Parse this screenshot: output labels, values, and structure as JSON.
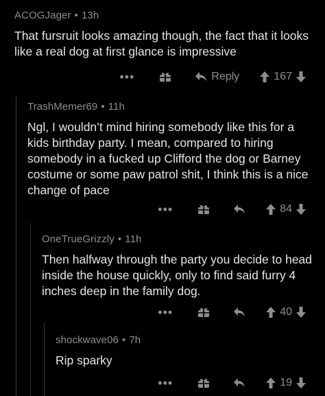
{
  "comments": [
    {
      "username": "ACOGJager",
      "age": "13h",
      "text": "That fursruit looks amazing though, the fact that it looks like a real dog at first glance is impressive",
      "reply_label": "Reply",
      "score": "167"
    },
    {
      "username": "TrashMemer69",
      "age": "11h",
      "text": "Ngl, I wouldn’t mind hiring somebody like this for a kids birthday party. I mean, compared to hiring somebody in a fucked up Clifford the dog or Barney costume or some paw patrol shit, I think this is a nice change of pace",
      "score": "84"
    },
    {
      "username": "OneTrueGrizzly",
      "age": "11h",
      "text": "Then halfway through the party you decide to head inside the house quickly, only to find said furry 4 inches deep in the family dog.",
      "score": "40"
    },
    {
      "username": "shockwave06",
      "age": "7h",
      "text": "Rip sparky",
      "score": "19"
    }
  ],
  "separator": "•",
  "more_glyph": "•••",
  "icons": {
    "more": "more-options-icon",
    "gift": "gift-award-icon",
    "reply": "reply-arrow-icon",
    "upvote": "upvote-arrow-icon",
    "downvote": "downvote-arrow-icon"
  },
  "colors": {
    "background": "#000000",
    "text": "#e6e6e6",
    "muted": "#8e8e8e",
    "thread_line": "#3a3a3a"
  }
}
